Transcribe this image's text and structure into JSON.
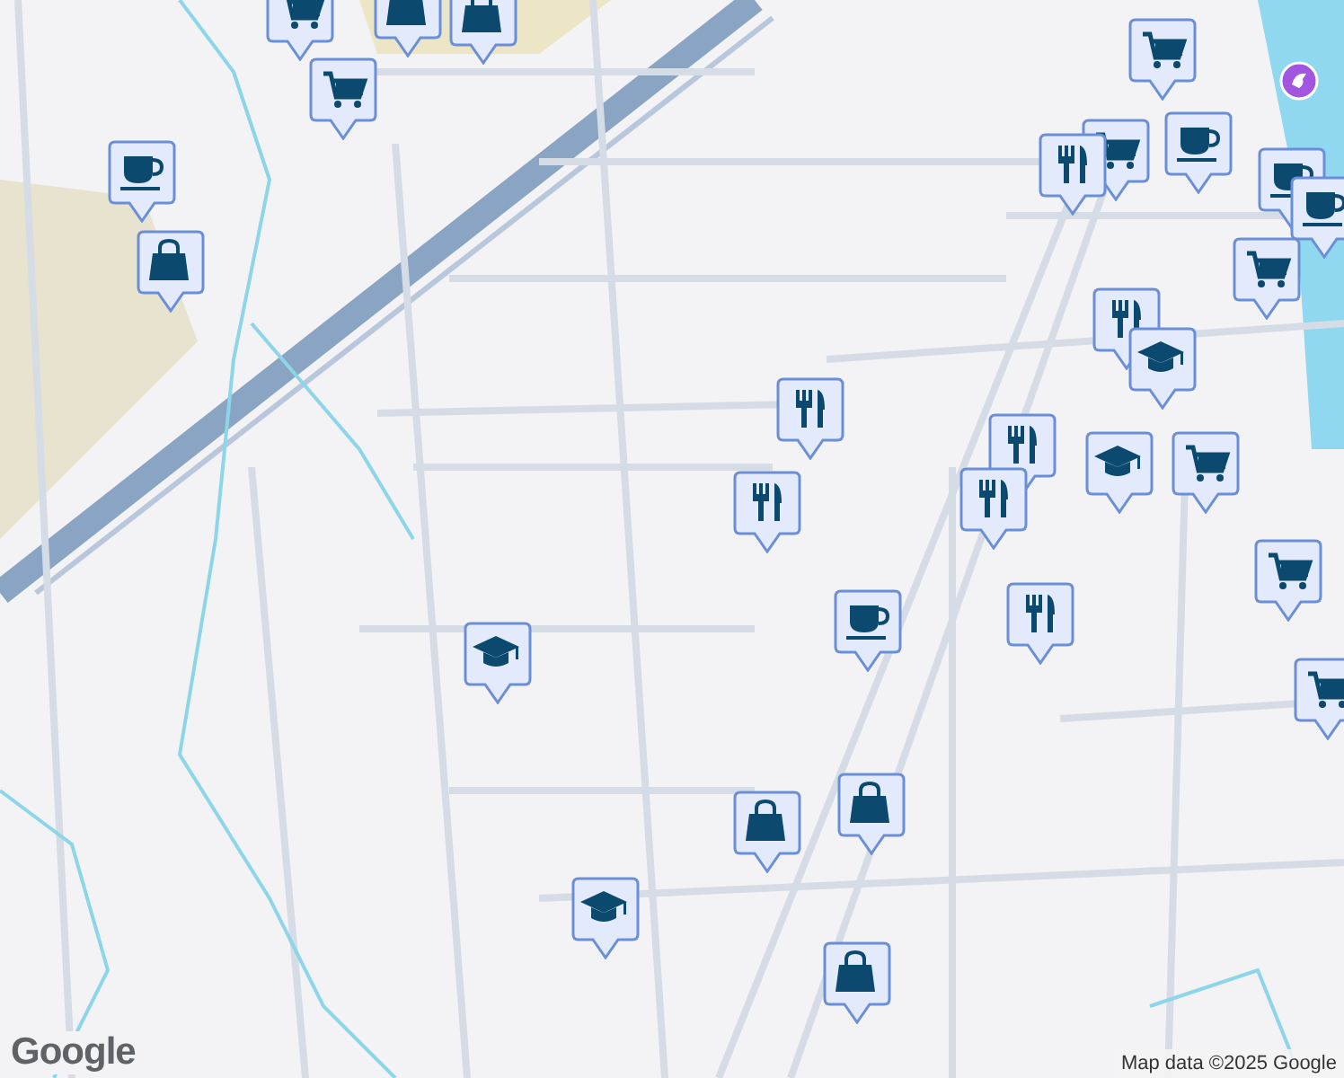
{
  "map": {
    "markers": [
      {
        "kind": "cart"
      },
      {
        "kind": "bag"
      },
      {
        "kind": "bag"
      },
      {
        "kind": "cart"
      },
      {
        "kind": "coffee"
      },
      {
        "kind": "bag"
      },
      {
        "kind": "cart"
      },
      {
        "kind": "cart"
      },
      {
        "kind": "restaurant"
      },
      {
        "kind": "coffee"
      },
      {
        "kind": "coffee"
      },
      {
        "kind": "coffee"
      },
      {
        "kind": "cart"
      },
      {
        "kind": "restaurant"
      },
      {
        "kind": "school"
      },
      {
        "kind": "restaurant"
      },
      {
        "kind": "restaurant"
      },
      {
        "kind": "restaurant"
      },
      {
        "kind": "restaurant"
      },
      {
        "kind": "school"
      },
      {
        "kind": "cart"
      },
      {
        "kind": "cart"
      },
      {
        "kind": "cart"
      },
      {
        "kind": "coffee"
      },
      {
        "kind": "restaurant"
      },
      {
        "kind": "school"
      },
      {
        "kind": "bag"
      },
      {
        "kind": "bag"
      },
      {
        "kind": "school"
      },
      {
        "kind": "bag"
      }
    ]
  },
  "attribution": "Map data ©2025 Google",
  "logo": "Google"
}
